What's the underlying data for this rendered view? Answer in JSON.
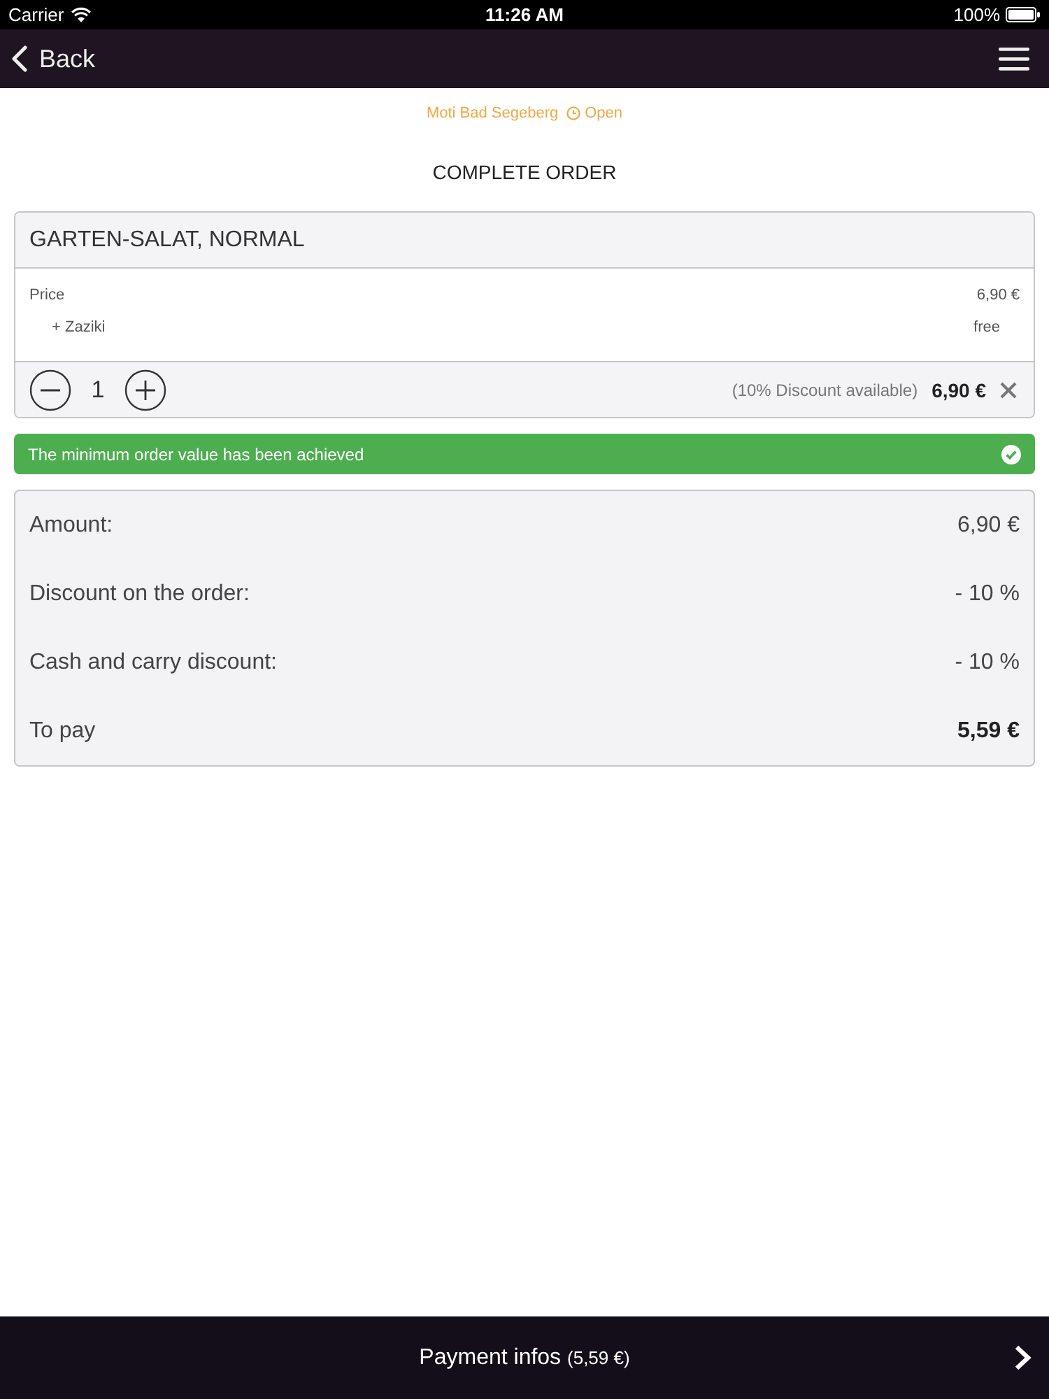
{
  "status_bar": {
    "carrier": "Carrier",
    "time": "11:26 AM",
    "battery": "100%"
  },
  "nav_bar": {
    "back": "Back"
  },
  "restaurant": {
    "name": "Moti Bad Segeberg",
    "status": "Open"
  },
  "title": "COMPLETE ORDER",
  "order_item": {
    "name": "GARTEN-SALAT, NORMAL",
    "lines": [
      {
        "kind": "price",
        "label": "Price",
        "value": "6,90 €"
      },
      {
        "kind": "extra",
        "label": "+ Zaziki",
        "value": "free"
      }
    ],
    "quantity": "1",
    "discount_note": "(10% Discount available)",
    "total": "6,90 €"
  },
  "notice": {
    "text": "The minimum order value has been achieved"
  },
  "summary": [
    {
      "kind": "normal",
      "label": "Amount:",
      "value": "6,90 €"
    },
    {
      "kind": "normal",
      "label": "Discount on the order:",
      "value": "- 10 %"
    },
    {
      "kind": "normal",
      "label": "Cash and carry discount:",
      "value": "- 10 %"
    },
    {
      "kind": "total",
      "label": "To pay",
      "value": "5,59 €"
    }
  ],
  "payment_button": {
    "label": "Payment infos",
    "amount": "(5,59 €)"
  }
}
